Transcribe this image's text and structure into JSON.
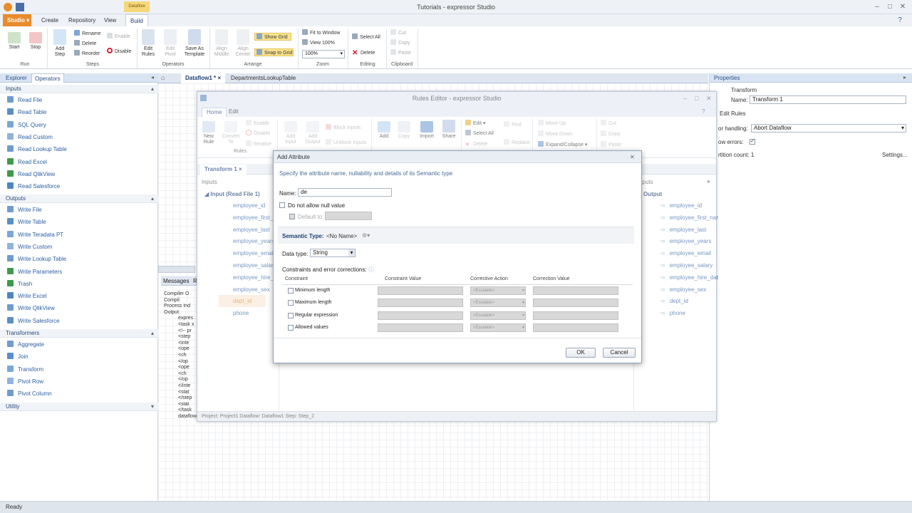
{
  "app": {
    "title": "Tutorials - expressor Studio"
  },
  "ribbon_tabs": {
    "studio": "Studio",
    "create": "Create",
    "repository": "Repository",
    "view": "View",
    "build": "Build",
    "context": "Dataflow"
  },
  "ribbon": {
    "run": {
      "label": "Run",
      "start": "Start",
      "stop": "Stop"
    },
    "steps": {
      "label": "Steps",
      "add_step": "Add Step",
      "rename": "Rename",
      "delete": "Delete",
      "reorder": "Reorder",
      "enable": "Enable",
      "disable": "Disable"
    },
    "operators": {
      "label": "Operators",
      "edit_rules": "Edit Rules",
      "edit_pivot": "Edit Pivot",
      "save_as_template": "Save As Template"
    },
    "arrange": {
      "label": "Arrange",
      "align_middle": "Align Middle",
      "align_center": "Align Center",
      "show_grid": "Show Grid",
      "snap_to_grid": "Snap to Grid"
    },
    "zoom": {
      "label": "Zoom",
      "fit_to_window": "Fit to Window",
      "view_100": "View 100%",
      "zoom_value": "100%"
    },
    "editing": {
      "label": "Editing",
      "select_all": "Select All",
      "delete": "Delete"
    },
    "clipboard": {
      "label": "Clipboard",
      "cut": "Cut",
      "copy": "Copy",
      "paste": "Paste"
    }
  },
  "left_panel": {
    "tabs": [
      "Explorer",
      "Operators"
    ],
    "inputs": {
      "title": "Inputs",
      "items": [
        "Read File",
        "Read Table",
        "SQL Query",
        "Read Custom",
        "Read Lookup Table",
        "Read Excel",
        "Read QlikView",
        "Read Salesforce"
      ]
    },
    "outputs": {
      "title": "Outputs",
      "items": [
        "Write File",
        "Write Table",
        "Write Teradata PT",
        "Write Custom",
        "Write Lookup Table",
        "Write Parameters",
        "Trash",
        "Write Excel",
        "Write QlikView",
        "Write Salesforce"
      ]
    },
    "transformers": {
      "title": "Transformers",
      "items": [
        "Aggregate",
        "Join",
        "Transform",
        "Pivot Row",
        "Pivot Column"
      ]
    },
    "utility": {
      "title": "Utility"
    }
  },
  "center_tabs": [
    "Dataflow1 *",
    "DepartmentsLookupTable"
  ],
  "messages": {
    "tabs": [
      "Messages",
      "R"
    ],
    "lines": [
      "Compiler O",
      "Compil",
      "Process Ind",
      "Output",
      "expres",
      "<task x",
      "<!-- pr",
      "<step",
      "<inte",
      "<ope",
      "<ch",
      "</op",
      "<ope",
      "<ch",
      "</op",
      "</inte",
      "<stat",
      "</step",
      "<stat",
      "</task",
      "dataflow"
    ]
  },
  "right_panel": {
    "title": "Properties",
    "header": "Transform",
    "name_label": "Name:",
    "name_value": "Transform 1",
    "edit_rules": "Edit Rules",
    "error_handling_label": "or handling:",
    "error_handling_value": "Abort Dataflow",
    "show_errors_label": "ow errors:",
    "partition_label": "rtition count:",
    "partition_value": "1",
    "settings": "Settings..."
  },
  "rules_editor": {
    "title": "Rules Editor - expressor Studio",
    "tabs": [
      "Home",
      "Edit"
    ],
    "ribbon": {
      "new_rule": "New Rule",
      "convert_to": "Convert To",
      "enable": "Enable",
      "disable": "Disable",
      "iterative": "Iterative",
      "rules_label": "Rules",
      "add_input": "Add Input",
      "add_output": "Add Output",
      "block_inputs": "Block Inputs",
      "unblock_inputs": "Unblock Inputs",
      "add": "Add",
      "copy": "Copy",
      "import": "Import",
      "share": "Share",
      "edit": "Edit",
      "select_all": "Select All",
      "delete": "Delete",
      "find": "Find",
      "replace": "Replace",
      "move_up": "Move Up",
      "move_down": "Move Down",
      "expand_collapse": "Expand/Collapse",
      "cut": "Cut",
      "copy2": "Copy",
      "paste": "Paste"
    },
    "doc_tab": "Transform 1",
    "inputs_label": "Inputs",
    "outputs_label": "utputs",
    "input_header": "Input (Read File 1)",
    "input_attrs": [
      "employee_id",
      "employee_first_n",
      "employee_last",
      "employee_years",
      "employee_email",
      "employee_salary",
      "employee_hire_d",
      "employee_sex",
      "dept_id",
      "phone"
    ],
    "output_header": "Output",
    "output_attrs": [
      "employee_id",
      "employee_first_nar",
      "employee_last",
      "employee_years",
      "employee_email",
      "employee_salary",
      "employee_hire_dat",
      "employee_sex",
      "dept_id",
      "phone"
    ],
    "status": "Project: Project1  Dataflow: Dataflow1  Step: Step_2"
  },
  "dialog": {
    "title": "Add Attribute",
    "subtitle": "Specify the attribute name, nullability and details of its Semantic type",
    "name_label": "Name:",
    "name_value": "de",
    "not_null": "Do not allow null value",
    "default_to": "Default to:",
    "semantic_label": "Semantic Type:",
    "semantic_value": "<No Name>",
    "data_type_label": "Data type:",
    "data_type_value": "String",
    "constraints_label": "Constraints and error corrections:",
    "columns": [
      "Constraint",
      "Constraint Value",
      "Corrective Action",
      "Correction Value"
    ],
    "rows": [
      "Minimum length",
      "Maximum length",
      "Regular expression",
      "Allowed values"
    ],
    "escalate": "<Escalate>",
    "ok": "OK",
    "cancel": "Cancel"
  },
  "status_bar": {
    "text": "Ready"
  }
}
